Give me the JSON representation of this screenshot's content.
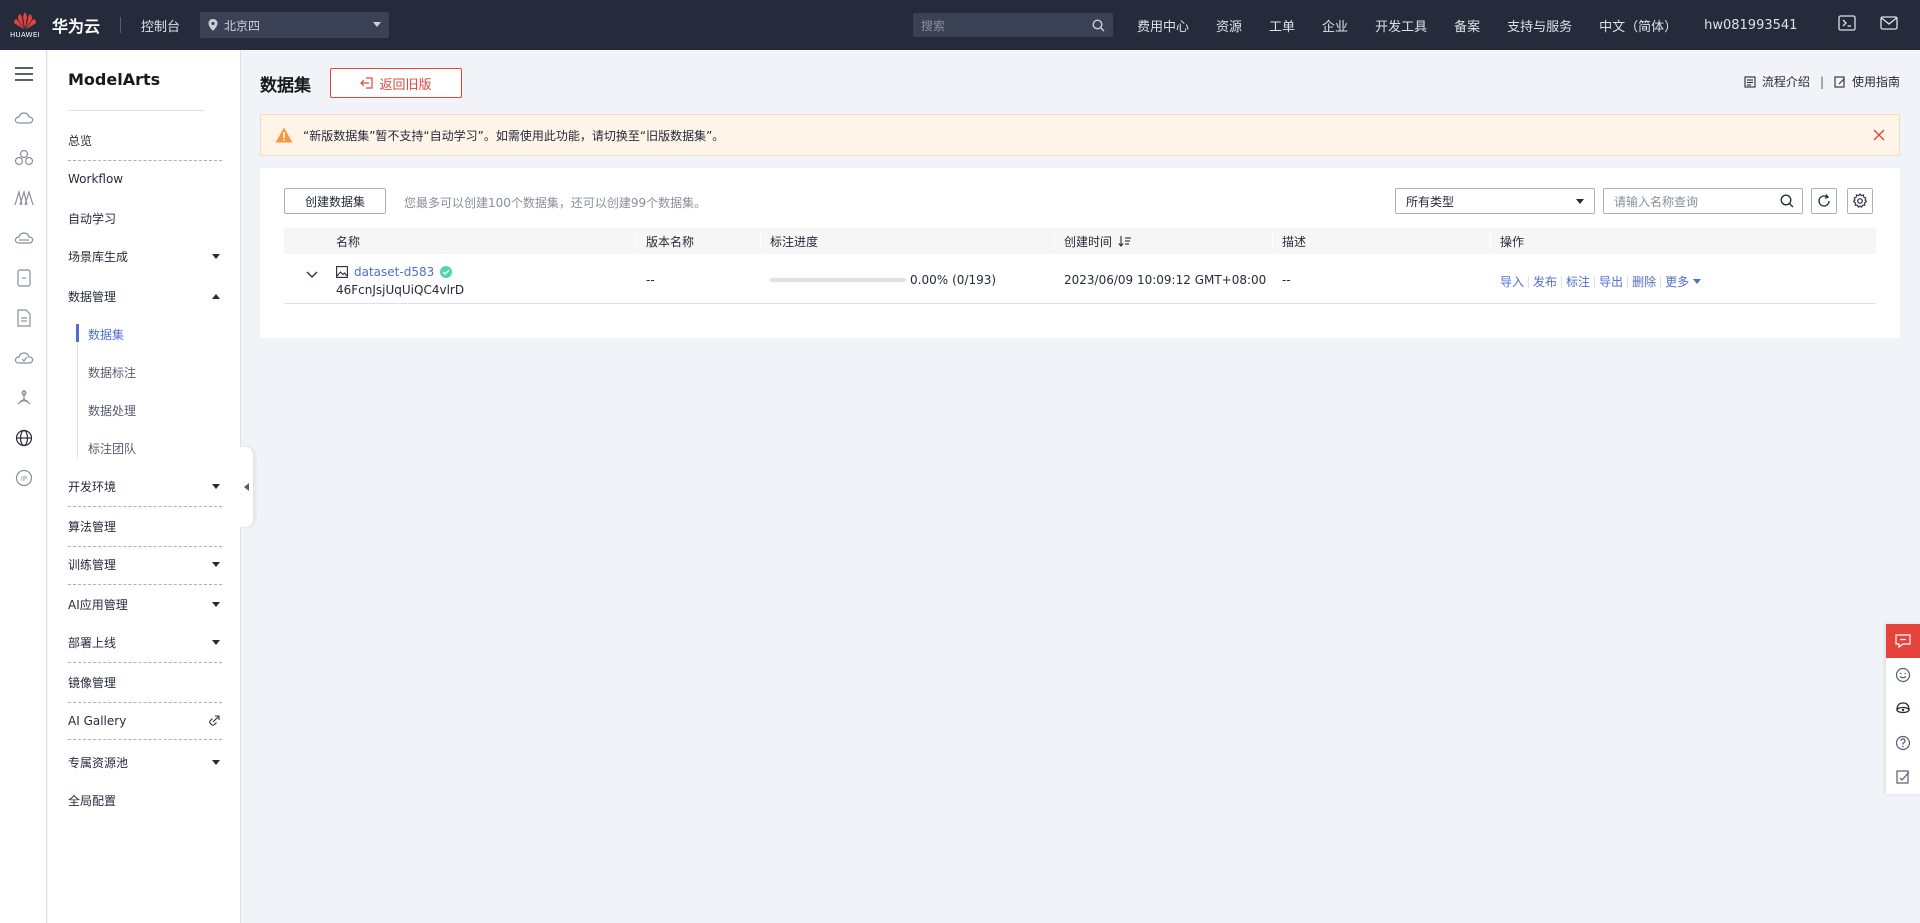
{
  "topbar": {
    "logo_small_text": "HUAWEI",
    "brand": "华为云",
    "console": "控制台",
    "region": "北京四",
    "search_placeholder": "搜索",
    "nav": [
      "费用中心",
      "资源",
      "工单",
      "企业",
      "开发工具",
      "备案",
      "支持与服务",
      "中文（简体）",
      "hw081993541"
    ],
    "icons": [
      "terminal-icon",
      "mail-icon"
    ]
  },
  "rail_icons": [
    "cloud-icon",
    "cluster-icon",
    "mountains-icon",
    "cloud-2-icon",
    "server-icon",
    "document-icon",
    "cloud-3-icon",
    "satellite-icon",
    "globe-icon",
    "ip-icon"
  ],
  "sidebar": {
    "title": "ModelArts",
    "items": {
      "overview": "总览",
      "workflow": "Workflow",
      "automl": "自动学习",
      "scene": "场景库生成",
      "data_mgmt": "数据管理",
      "dataset": "数据集",
      "labeling": "数据标注",
      "processing": "数据处理",
      "team": "标注团队",
      "devenv": "开发环境",
      "algo": "算法管理",
      "train": "训练管理",
      "aiapp": "AI应用管理",
      "deploy": "部署上线",
      "image": "镜像管理",
      "gallery": "AI Gallery",
      "pool": "专属资源池",
      "global": "全局配置"
    }
  },
  "page": {
    "title": "数据集",
    "old_version_button": "返回旧版",
    "flow_intro": "流程介绍",
    "guide": "使用指南",
    "header_sep": "|",
    "alert": "“新版数据集”暂不支持“自动学习”。如需使用此功能，请切换至“旧版数据集”。"
  },
  "toolbar": {
    "create_button": "创建数据集",
    "quota": "您最多可以创建100个数据集，还可以创建99个数据集。",
    "type_select": "所有类型",
    "name_query_placeholder": "请输入名称查询"
  },
  "table": {
    "headers": [
      "名称",
      "版本名称",
      "标注进度",
      "创建时间",
      "描述",
      "操作"
    ],
    "rows": [
      {
        "name": "dataset-d583",
        "id": "46FcnJsjUqUiQC4vlrD",
        "version": "--",
        "progress_fraction": 0.0,
        "progress_text": "0.00%",
        "progress_count": "(0/193)",
        "created": "2023/06/09 10:09:12 GMT+08:00",
        "description": "--",
        "ops": [
          "导入",
          "发布",
          "标注",
          "导出",
          "删除",
          "更多"
        ]
      }
    ]
  },
  "float_icons": [
    "chat-icon",
    "smile-icon",
    "headset-icon",
    "help-icon",
    "note-icon"
  ],
  "colors": {
    "topbar": "#252b3a",
    "link": "#526ecc",
    "danger": "#e5443d",
    "warning": "#fa9841",
    "success": "#50d4ab"
  }
}
